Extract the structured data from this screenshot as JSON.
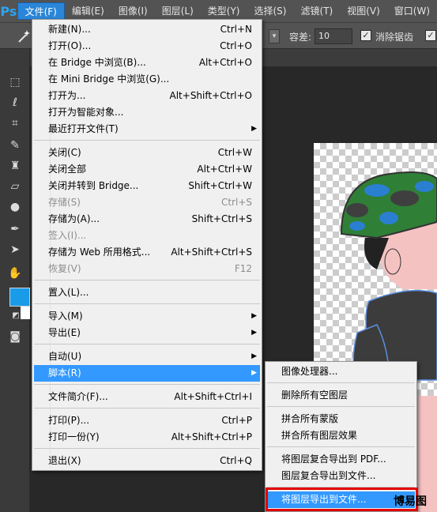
{
  "app": {
    "logo": "Ps"
  },
  "menubar": [
    {
      "label": "文件(F)",
      "active": true
    },
    {
      "label": "编辑(E)"
    },
    {
      "label": "图像(I)"
    },
    {
      "label": "图层(L)"
    },
    {
      "label": "类型(Y)"
    },
    {
      "label": "选择(S)"
    },
    {
      "label": "滤镜(T)"
    },
    {
      "label": "视图(V)"
    },
    {
      "label": "窗口(W)"
    }
  ],
  "options": {
    "tolerance_label": "容差:",
    "tolerance_value": "10",
    "antialias_label": "消除锯齿",
    "antialias_checked": true
  },
  "file_menu": [
    {
      "label": "新建(N)...",
      "shortcut": "Ctrl+N"
    },
    {
      "label": "打开(O)...",
      "shortcut": "Ctrl+O"
    },
    {
      "label": "在 Bridge 中浏览(B)...",
      "shortcut": "Alt+Ctrl+O"
    },
    {
      "label": "在 Mini Bridge 中浏览(G)...",
      "shortcut": ""
    },
    {
      "label": "打开为...",
      "shortcut": "Alt+Shift+Ctrl+O"
    },
    {
      "label": "打开为智能对象...",
      "shortcut": ""
    },
    {
      "label": "最近打开文件(T)",
      "shortcut": "",
      "submenu": true
    },
    {
      "label": "关闭(C)",
      "shortcut": "Ctrl+W"
    },
    {
      "label": "关闭全部",
      "shortcut": "Alt+Ctrl+W"
    },
    {
      "label": "关闭并转到 Bridge...",
      "shortcut": "Shift+Ctrl+W"
    },
    {
      "label": "存储(S)",
      "shortcut": "Ctrl+S",
      "disabled": true
    },
    {
      "label": "存储为(A)...",
      "shortcut": "Shift+Ctrl+S"
    },
    {
      "label": "签入(I)...",
      "shortcut": "",
      "disabled": true
    },
    {
      "label": "存储为 Web 所用格式...",
      "shortcut": "Alt+Shift+Ctrl+S"
    },
    {
      "label": "恢复(V)",
      "shortcut": "F12",
      "disabled": true
    },
    {
      "label": "置入(L)...",
      "shortcut": ""
    },
    {
      "label": "导入(M)",
      "shortcut": "",
      "submenu": true
    },
    {
      "label": "导出(E)",
      "shortcut": "",
      "submenu": true
    },
    {
      "label": "自动(U)",
      "shortcut": "",
      "submenu": true
    },
    {
      "label": "脚本(R)",
      "shortcut": "",
      "submenu": true,
      "highlighted": true
    },
    {
      "label": "文件简介(F)...",
      "shortcut": "Alt+Shift+Ctrl+I"
    },
    {
      "label": "打印(P)...",
      "shortcut": "Ctrl+P"
    },
    {
      "label": "打印一份(Y)",
      "shortcut": "Alt+Shift+Ctrl+P"
    },
    {
      "label": "退出(X)",
      "shortcut": "Ctrl+Q"
    }
  ],
  "scripts_submenu": [
    {
      "label": "图像处理器..."
    },
    {
      "label": "删除所有空图层"
    },
    {
      "label": "拼合所有蒙版"
    },
    {
      "label": "拼合所有图层效果"
    },
    {
      "label": "将图层复合导出到 PDF..."
    },
    {
      "label": "图层复合导出到文件..."
    },
    {
      "label": "将图层导出到文件...",
      "highlighted": true
    }
  ],
  "watermark": "博易图",
  "colors": {
    "accent": "#3399ff",
    "foreground_swatch": "#1a9be8",
    "callout": "#e30000"
  }
}
